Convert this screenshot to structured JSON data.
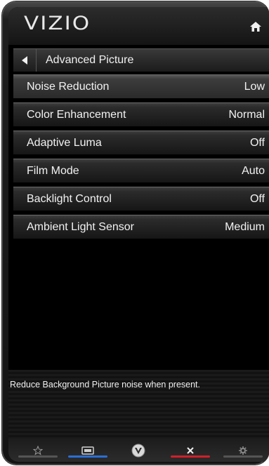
{
  "header": {
    "logo_text": "VIZIO",
    "home_icon": "home-icon"
  },
  "breadcrumb": {
    "back_icon": "back-arrow-icon",
    "title": "Advanced Picture"
  },
  "menu": {
    "items": [
      {
        "label": "Noise Reduction",
        "value": "Low",
        "selected": true
      },
      {
        "label": "Color Enhancement",
        "value": "Normal",
        "selected": false
      },
      {
        "label": "Adaptive Luma",
        "value": "Off",
        "selected": false
      },
      {
        "label": "Film Mode",
        "value": "Auto",
        "selected": false
      },
      {
        "label": "Backlight Control",
        "value": "Off",
        "selected": false
      },
      {
        "label": "Ambient Light Sensor",
        "value": "Medium",
        "selected": false
      }
    ]
  },
  "description": {
    "text": "Reduce Background Picture noise when present."
  },
  "navbar": {
    "buttons": [
      {
        "icon": "star-icon",
        "accent": "#555555"
      },
      {
        "icon": "input-icon",
        "accent": "#2a6fd6"
      },
      {
        "icon": "vizio-v-icon",
        "accent": "none"
      },
      {
        "icon": "close-x-icon",
        "accent": "#d0202a"
      },
      {
        "icon": "gear-icon",
        "accent": "#555555"
      }
    ]
  },
  "colors": {
    "text": "#f2f2f2",
    "blue_accent": "#2a6fd6",
    "red_accent": "#d0202a"
  }
}
